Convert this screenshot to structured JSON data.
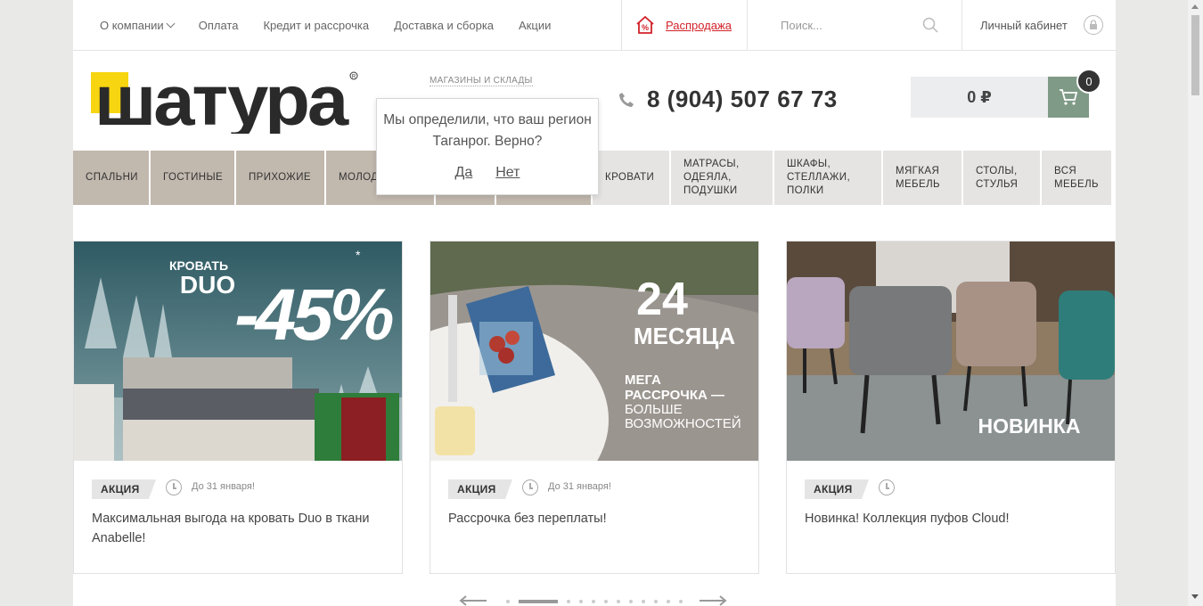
{
  "topnav": {
    "about": "О компании",
    "payment": "Оплата",
    "credit": "Кредит и рассрочка",
    "delivery": "Доставка и сборка",
    "promos": "Акции",
    "sale": "Распродажа",
    "search_placeholder": "Поиск...",
    "account": "Личный кабинет"
  },
  "header": {
    "logo_text": "шатура",
    "stores": "МАГАЗИНЫ И СКЛАДЫ",
    "phone": "8 (904) 507 67 73",
    "cart_sum": "0 ₽",
    "cart_count": "0"
  },
  "categories": [
    {
      "label": "Спальни",
      "style": "dark",
      "width": 85
    },
    {
      "label": "Гостиные",
      "style": "dark",
      "width": 94
    },
    {
      "label": "Прихожие",
      "style": "dark",
      "width": 99
    },
    {
      "label": "Молодежные",
      "style": "dark",
      "width": 121
    },
    {
      "label": "",
      "style": "dark",
      "width": 66
    },
    {
      "label": "",
      "style": "dark",
      "width": 106
    },
    {
      "label": "Кровати",
      "style": "light",
      "width": 86
    },
    {
      "label": "Матрасы, одеяла, подушки",
      "style": "light",
      "width": 114
    },
    {
      "label": "Шкафы, стеллажи, полки",
      "style": "light",
      "width": 120
    },
    {
      "label": "Мягкая мебель",
      "style": "light",
      "width": 88
    },
    {
      "label": "Столы, стулья",
      "style": "light",
      "width": 86
    },
    {
      "label": "Вся мебель",
      "style": "light",
      "width": 78
    }
  ],
  "popup": {
    "message": "Мы определили, что ваш регион Таганрог. Верно?",
    "yes": "Да",
    "no": "Нет"
  },
  "cards": [
    {
      "badge": "АКЦИЯ",
      "date": "До 31 января!",
      "text": "Максимальная выгода на кровать Duo в ткани Anabelle!",
      "banner": {
        "line1": "КРОВАТЬ",
        "line2": "DUO",
        "discount": "-45%",
        "star": "*"
      }
    },
    {
      "badge": "АКЦИЯ",
      "date": "До 31 января!",
      "text": "Рассрочка без переплаты!",
      "banner": {
        "big": "24",
        "mid": "МЕСЯЦА",
        "l1": "МЕГА",
        "l2": "РАССРОЧКА —",
        "l3": "БОЛЬШЕ",
        "l4": "ВОЗМОЖНОСТЕЙ"
      }
    },
    {
      "badge": "АКЦИЯ",
      "date": "",
      "text": "Новинка! Коллекция пуфов Cloud!",
      "banner": {
        "label": "НОВИНКА"
      }
    }
  ],
  "slider": {
    "pages": 12,
    "active": 2
  }
}
